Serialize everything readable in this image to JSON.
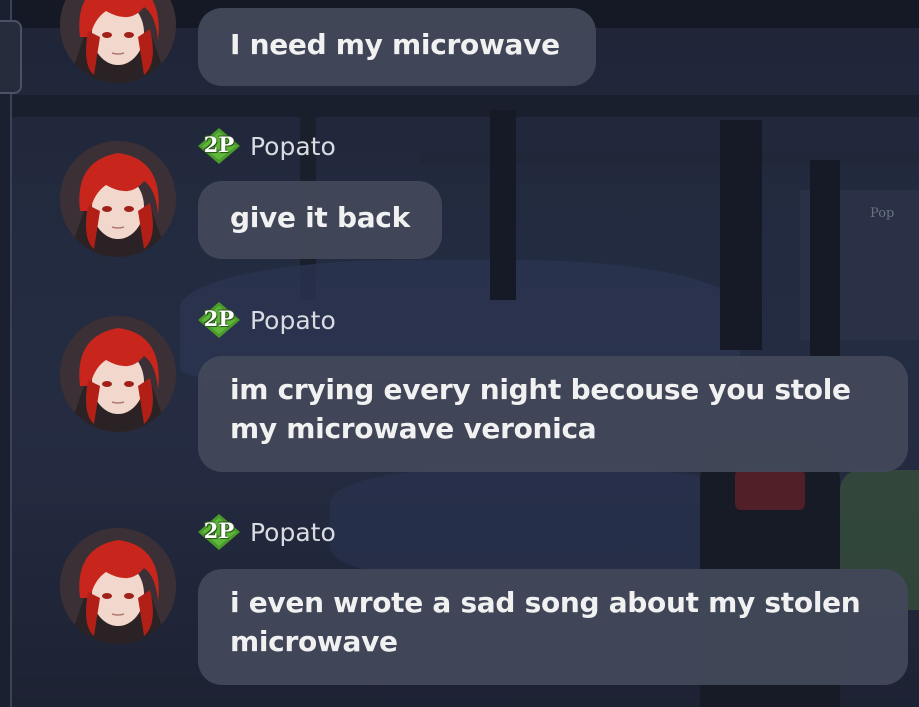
{
  "chat": {
    "messages": [
      {
        "sender": "",
        "badge": "",
        "text": "I need my microwave"
      },
      {
        "sender": "Popato",
        "badge": "2P",
        "text": "give it back"
      },
      {
        "sender": "Popato",
        "badge": "2P",
        "text": "im crying every night becouse you stole my microwave veronica"
      },
      {
        "sender": "Popato",
        "badge": "2P",
        "text": "i even wrote a sad song about my stolen microwave"
      }
    ]
  },
  "background": {
    "crate_label": "Pop"
  },
  "icons": {
    "avatar": "red-haired-character-avatar",
    "player_badge": "green-diamond-2p-badge"
  },
  "colors": {
    "bubble": "#424858",
    "badge_green": "#4a9a2c",
    "text": "#f1f1f1"
  }
}
